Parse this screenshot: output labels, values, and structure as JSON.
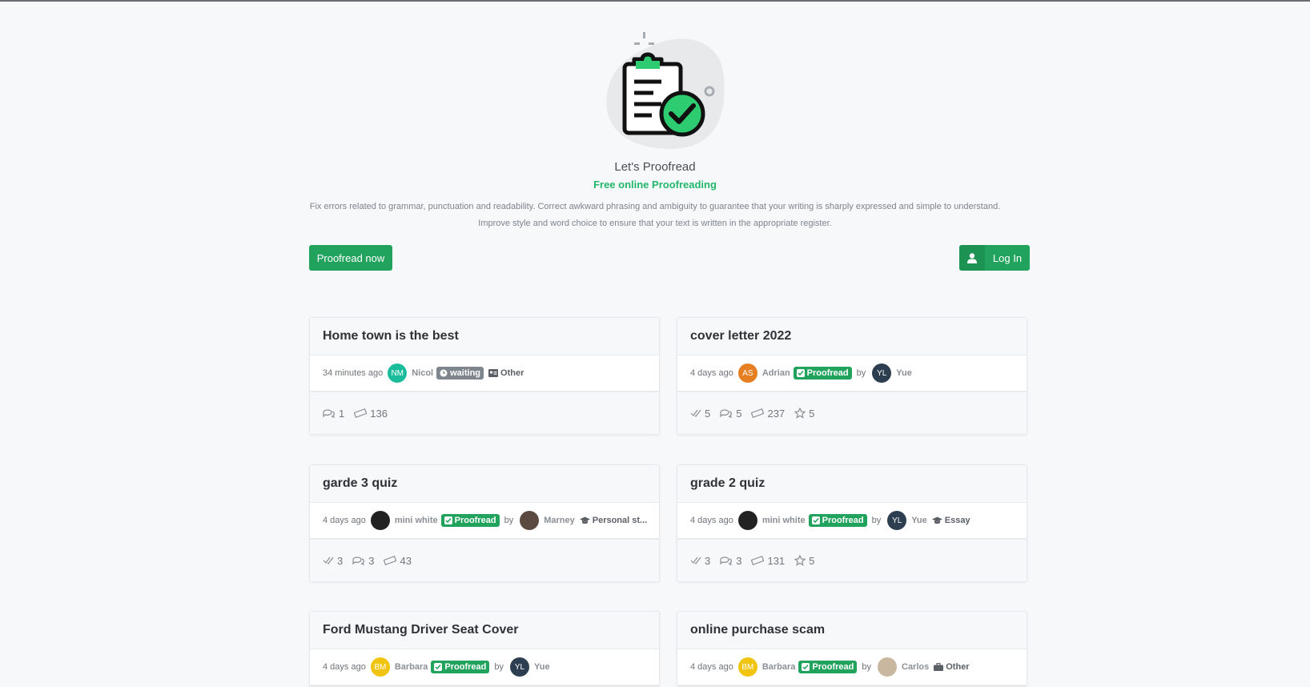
{
  "hero": {
    "app_name": "Let's Proofread",
    "tagline": "Free online Proofreading",
    "description_line1": "Fix errors related to grammar, punctuation and readability. Correct awkward phrasing and ambiguity to guarantee that your writing is sharply expressed and simple to understand.",
    "description_line2": "Improve style and word choice to ensure that your text is written in the appropriate register."
  },
  "buttons": {
    "proofread_now": "Proofread now",
    "log_in": "Log In"
  },
  "cards": [
    {
      "title": "Home town is the best",
      "time": "34 minutes ago",
      "author": {
        "initials": "NM",
        "name": "Nicol",
        "color": "#1abc9c"
      },
      "status": "waiting",
      "category": "Other",
      "stats": {
        "comments": "1",
        "words": "136"
      }
    },
    {
      "title": "cover letter 2022",
      "time": "4 days ago",
      "author": {
        "initials": "AS",
        "name": "Adrian",
        "color": "#e67e22"
      },
      "status": "Proofread",
      "by": "by",
      "reviewer": {
        "initials": "YL",
        "name": "Yue",
        "color": "#2c3e50"
      },
      "stats": {
        "checks": "5",
        "comments": "5",
        "words": "237",
        "stars": "5"
      }
    },
    {
      "title": "garde 3 quiz",
      "time": "4 days ago",
      "author": {
        "initials": "",
        "name": "mini white",
        "color": "#222222"
      },
      "status": "Proofread",
      "by": "by",
      "reviewer": {
        "initials": "",
        "name": "Marney",
        "color": "#5a4a42"
      },
      "category": "Personal st...",
      "stats": {
        "checks": "3",
        "comments": "3",
        "words": "43"
      }
    },
    {
      "title": "grade 2 quiz",
      "time": "4 days ago",
      "author": {
        "initials": "",
        "name": "mini white",
        "color": "#222222"
      },
      "status": "Proofread",
      "by": "by",
      "reviewer": {
        "initials": "YL",
        "name": "Yue",
        "color": "#2c3e50"
      },
      "category": "Essay",
      "stats": {
        "checks": "3",
        "comments": "3",
        "words": "131",
        "stars": "5"
      }
    },
    {
      "title": "Ford Mustang Driver Seat Cover",
      "time": "4 days ago",
      "author": {
        "initials": "BM",
        "name": "Barbara",
        "color": "#f1c40f"
      },
      "status": "Proofread",
      "by": "by",
      "reviewer": {
        "initials": "YL",
        "name": "Yue",
        "color": "#2c3e50"
      }
    },
    {
      "title": "online purchase scam",
      "time": "4 days ago",
      "author": {
        "initials": "BM",
        "name": "Barbara",
        "color": "#f1c40f"
      },
      "status": "Proofread",
      "by": "by",
      "reviewer": {
        "initials": "",
        "name": "Carlos",
        "color": "#c9b7a0"
      },
      "category": "Other"
    }
  ]
}
